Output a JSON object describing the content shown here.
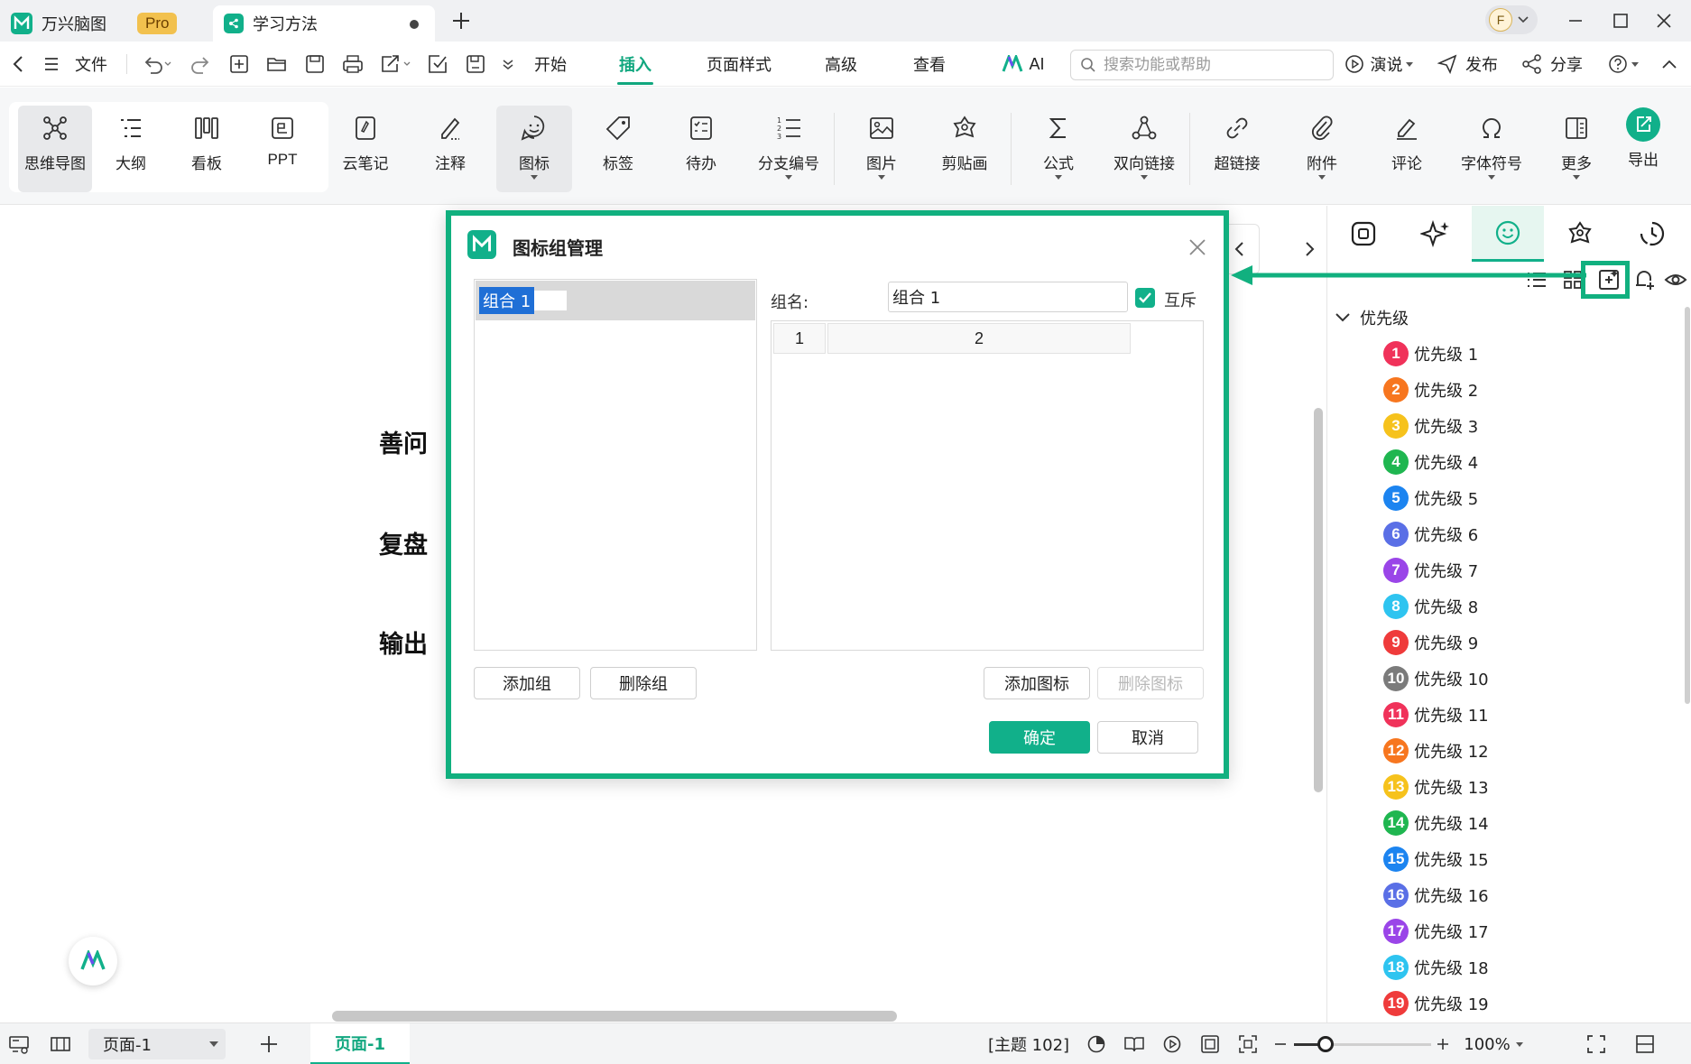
{
  "titlebar": {
    "app_name": "万兴脑图",
    "pro_badge": "Pro",
    "doc_tab": "学习方法",
    "avatar_letter": "F"
  },
  "menubar": {
    "file": "文件",
    "tabs": [
      "开始",
      "插入",
      "页面样式",
      "高级",
      "查看"
    ],
    "active_tab": "插入",
    "ai": "AI",
    "search_placeholder": "搜索功能或帮助",
    "present": "演说",
    "publish": "发布",
    "share": "分享"
  },
  "ribbon": {
    "views": [
      "思维导图",
      "大纲",
      "看板",
      "PPT"
    ],
    "selected_view": "思维导图",
    "tools": [
      "云笔记",
      "注释",
      "图标",
      "标签",
      "待办",
      "分支编号",
      "图片",
      "剪贴画",
      "公式",
      "双向链接",
      "超链接",
      "附件",
      "评论",
      "字体符号",
      "更多"
    ],
    "selected_tool": "图标",
    "export": "导出"
  },
  "canvas": {
    "nodes": [
      "善问",
      "复盘",
      "输出"
    ]
  },
  "dialog": {
    "title": "图标组管理",
    "group_name_label": "组名:",
    "group_name_value": "组合 1",
    "selected_group": "组合 1",
    "mutex_label": "互斥",
    "mutex_checked": true,
    "table_columns": [
      "1",
      "2"
    ],
    "buttons": {
      "add_group": "添加组",
      "delete_group": "删除组",
      "add_icon": "添加图标",
      "delete_icon": "删除图标",
      "ok": "确定",
      "cancel": "取消"
    }
  },
  "right_panel": {
    "group_title": "优先级",
    "items": [
      {
        "num": "1",
        "label": "优先级 1",
        "color": "#f0325a"
      },
      {
        "num": "2",
        "label": "优先级 2",
        "color": "#f7761f"
      },
      {
        "num": "3",
        "label": "优先级 3",
        "color": "#f6c21c"
      },
      {
        "num": "4",
        "label": "优先级 4",
        "color": "#1fb650"
      },
      {
        "num": "5",
        "label": "优先级 5",
        "color": "#1c84f0"
      },
      {
        "num": "6",
        "label": "优先级 6",
        "color": "#5a6fe6"
      },
      {
        "num": "7",
        "label": "优先级 7",
        "color": "#9a45e8"
      },
      {
        "num": "8",
        "label": "优先级 8",
        "color": "#2ec4f0"
      },
      {
        "num": "9",
        "label": "优先级 9",
        "color": "#ef3b3b"
      },
      {
        "num": "10",
        "label": "优先级 10",
        "color": "#7b7b7b"
      },
      {
        "num": "11",
        "label": "优先级 11",
        "color": "#f0325a"
      },
      {
        "num": "12",
        "label": "优先级 12",
        "color": "#f7761f"
      },
      {
        "num": "13",
        "label": "优先级 13",
        "color": "#f6c21c"
      },
      {
        "num": "14",
        "label": "优先级 14",
        "color": "#1fb650"
      },
      {
        "num": "15",
        "label": "优先级 15",
        "color": "#1c84f0"
      },
      {
        "num": "16",
        "label": "优先级 16",
        "color": "#5a6fe6"
      },
      {
        "num": "17",
        "label": "优先级 17",
        "color": "#9a45e8"
      },
      {
        "num": "18",
        "label": "优先级 18",
        "color": "#2ec4f0"
      },
      {
        "num": "19",
        "label": "优先级 19",
        "color": "#ef3b3b"
      }
    ]
  },
  "statusbar": {
    "page_select": "页面-1",
    "page_tab": "页面-1",
    "topic_count": "[主题 102]",
    "zoom": "100%",
    "zoom_fraction": 0.23
  },
  "colors": {
    "accent": "#11b08a",
    "highlight": "#11b07f"
  }
}
